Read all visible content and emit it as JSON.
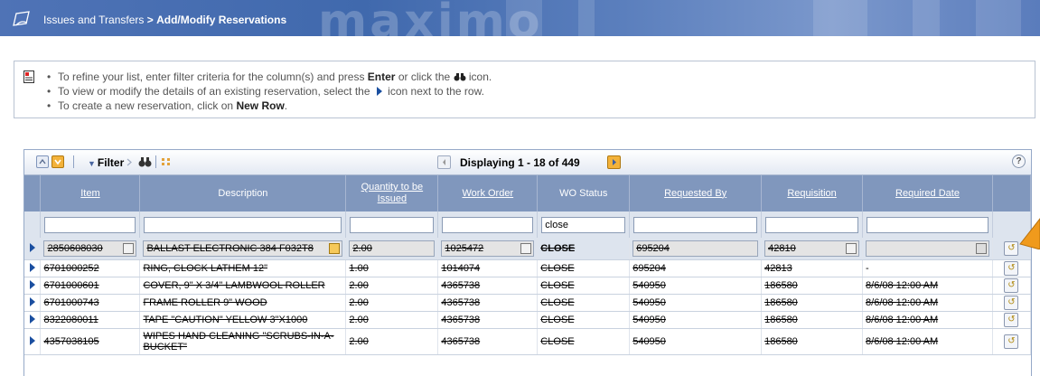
{
  "header": {
    "breadcrumb_app": "Issues and Transfers",
    "breadcrumb_sep": ">",
    "breadcrumb_page": "Add/Modify Reservations",
    "watermark": "maximo"
  },
  "help": {
    "line1_pre": "To refine your list, enter filter criteria for the column(s) and press ",
    "line1_bold": "Enter",
    "line1_post": " or click the ",
    "line1_end": " icon.",
    "line2_pre": "To view or modify the details of an existing reservation, select the ",
    "line2_post": " icon next to the row.",
    "line3_pre": "To create a new reservation, click on ",
    "line3_bold": "New Row",
    "line3_post": "."
  },
  "toolbar": {
    "filter_label": "Filter",
    "pager_text": "Displaying 1 - 18 of 449",
    "help_symbol": "?"
  },
  "columns": [
    "Item",
    "Description",
    "Quantity to be Issued",
    "Work Order",
    "WO Status",
    "Requested By",
    "Requisition",
    "Required Date"
  ],
  "filters": {
    "item": "",
    "description": "",
    "quantity": "",
    "work_order": "",
    "wo_status": "close",
    "requested_by": "",
    "requisition": "",
    "required_date": ""
  },
  "selected_row": {
    "item": "2850608030",
    "description": "BALLAST ELECTRONIC 384 F032T8",
    "quantity": "2.00",
    "work_order": "1025472",
    "wo_status": "CLOSE",
    "requested_by": "695204",
    "requisition": "42810",
    "required_date": ""
  },
  "rows": [
    {
      "item": "6701000252",
      "description": "RING, CLOCK LATHEM 12\"",
      "quantity": "1.00",
      "work_order": "1014074",
      "wo_status": "CLOSE",
      "requested_by": "695204",
      "requisition": "42813",
      "required_date": "-"
    },
    {
      "item": "6701000601",
      "description": "COVER, 9\" X 3/4\" LAMBWOOL ROLLER",
      "quantity": "2.00",
      "work_order": "4365738",
      "wo_status": "CLOSE",
      "requested_by": "540950",
      "requisition": "186580",
      "required_date": "8/6/08 12:00 AM"
    },
    {
      "item": "6701000743",
      "description": "FRAME ROLLER 9\" WOOD",
      "quantity": "2.00",
      "work_order": "4365738",
      "wo_status": "CLOSE",
      "requested_by": "540950",
      "requisition": "186580",
      "required_date": "8/6/08 12:00 AM"
    },
    {
      "item": "8322080011",
      "description": "TAPE \"CAUTION\" YELLOW 3\"X1000",
      "quantity": "2.00",
      "work_order": "4365738",
      "wo_status": "CLOSE",
      "requested_by": "540950",
      "requisition": "186580",
      "required_date": "8/6/08 12:00 AM"
    },
    {
      "item": "4357038105",
      "description": "WIPES HAND CLEANING \"SCRUBS-IN-A-BUCKET\"",
      "quantity": "2.00",
      "work_order": "4365738",
      "wo_status": "CLOSE",
      "requested_by": "540950",
      "requisition": "186580",
      "required_date": "8/6/08 12:00 AM"
    }
  ],
  "colors": {
    "header_bar": "#4f73b6",
    "table_header": "#8097bd",
    "filter_row": "#dde4ee",
    "row_arrow": "#1b4fa0",
    "pointer_arrow": "#f09a1c"
  }
}
